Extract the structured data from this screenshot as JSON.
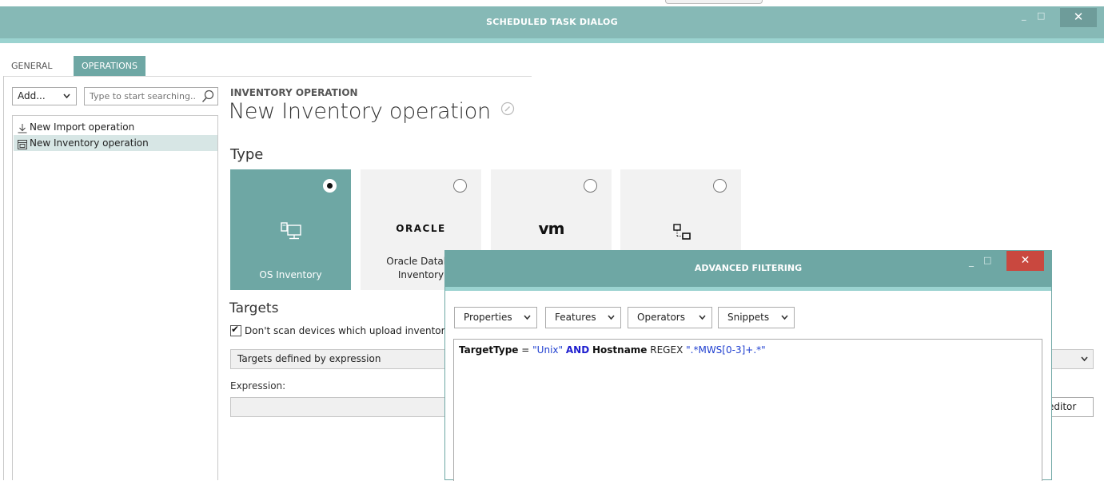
{
  "window": {
    "title": "SCHEDULED TASK DIALOG",
    "controls": {
      "minimize": "_",
      "maximize": "□",
      "close": "✕"
    }
  },
  "tabs": [
    {
      "label": "GENERAL",
      "active": false
    },
    {
      "label": "OPERATIONS",
      "active": true
    }
  ],
  "sidebar": {
    "add_button": "Add...",
    "search_placeholder": "Type to start searching...",
    "items": [
      {
        "label": "New Import operation",
        "icon": "download-icon",
        "selected": false
      },
      {
        "label": "New Inventory operation",
        "icon": "inventory-icon",
        "selected": true
      }
    ]
  },
  "operation": {
    "section_label": "INVENTORY OPERATION",
    "title": "New Inventory operation",
    "type_label": "Type",
    "types": [
      {
        "caption": "OS Inventory",
        "logo": "os-inventory-icon",
        "selected": true
      },
      {
        "caption": "Oracle Databa\nInventory",
        "logo": "ORACLE",
        "selected": false
      },
      {
        "caption": "",
        "logo": "vm",
        "selected": false
      },
      {
        "caption": "",
        "logo": "network-icon",
        "selected": false
      }
    ],
    "targets_label": "Targets",
    "dont_scan_label": "Don't scan devices which upload inventory",
    "dont_scan_checked": true,
    "targets_select_value": "Targets defined by expression",
    "expression_label": "Expression:",
    "expression_value": "",
    "editor_button": "editor"
  },
  "advanced_filtering": {
    "title": "ADVANCED FILTERING",
    "controls": {
      "minimize": "_",
      "maximize": "□",
      "close": "✕"
    },
    "dropdowns": [
      "Properties",
      "Features",
      "Operators",
      "Snippets"
    ],
    "expression": {
      "field1": "TargetType",
      "op1": "=",
      "value1": "\"Unix\"",
      "conj": "AND",
      "field2": "Hostname",
      "op2": "REGEX",
      "value2": "\".*MWS[0-3]+.*\""
    }
  },
  "colors": {
    "titlebar": "#86b9b6",
    "accent": "#9bd3d0",
    "teal": "#6ea7a4",
    "close_red": "#c9483f"
  }
}
